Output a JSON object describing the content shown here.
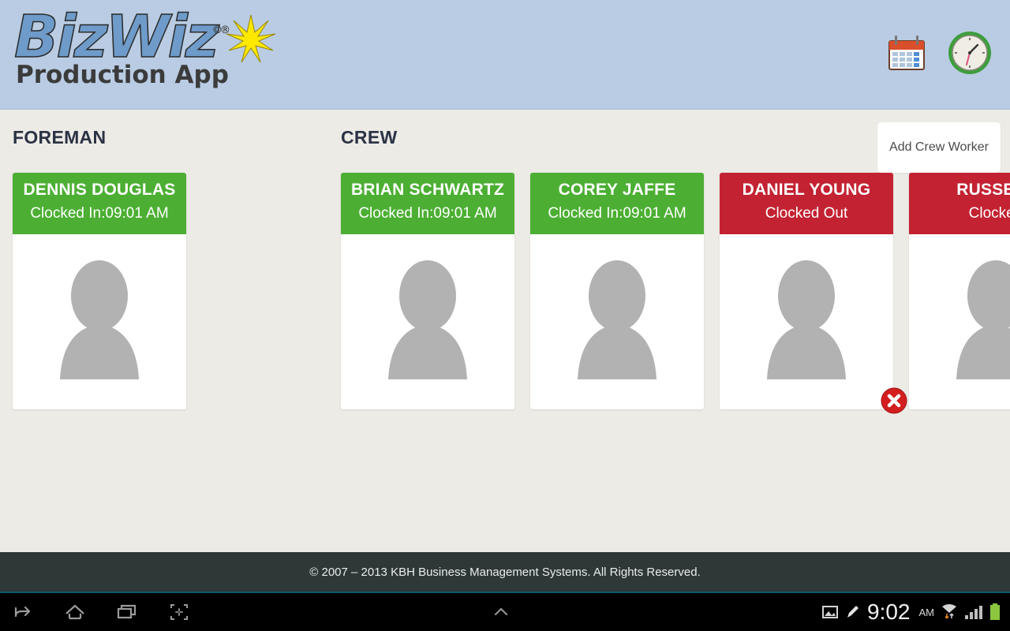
{
  "header": {
    "logo_main": "BizWiz",
    "logo_reg": "©®",
    "logo_sub": "Production App",
    "icons": [
      {
        "name": "calendar-icon",
        "label": "Calendar"
      },
      {
        "name": "clock-icon",
        "label": "Time Clock"
      }
    ]
  },
  "main": {
    "foreman_title": "FOREMAN",
    "crew_title": "CREW",
    "add_crew_label": "Add Crew Worker",
    "foreman": [
      {
        "name": "DENNIS DOUGLAS",
        "status": "Clocked In:09:01 AM",
        "state": "in",
        "has_delete": false
      }
    ],
    "crew": [
      {
        "name": "BRIAN SCHWARTZ",
        "status": "Clocked In:09:01 AM",
        "state": "in",
        "has_delete": false
      },
      {
        "name": "COREY JAFFE",
        "status": "Clocked In:09:01 AM",
        "state": "in",
        "has_delete": false
      },
      {
        "name": "DANIEL YOUNG",
        "status": "Clocked Out",
        "state": "out",
        "has_delete": true
      },
      {
        "name": "RUSSELL",
        "status": "Clocked",
        "state": "out",
        "has_delete": false
      }
    ]
  },
  "footer": {
    "copyright": "© 2007 – 2013 KBH Business Management Systems. All Rights Reserved."
  },
  "navbar": {
    "icons": [
      {
        "name": "back-icon"
      },
      {
        "name": "home-icon"
      },
      {
        "name": "recents-icon"
      },
      {
        "name": "screenshot-icon"
      }
    ],
    "center_icon": "chevron-up-icon",
    "status": {
      "time": "9:02",
      "ampm": "AM",
      "icons": [
        {
          "name": "image-icon"
        },
        {
          "name": "pencil-icon"
        },
        {
          "name": "wifi-icon"
        },
        {
          "name": "signal-icon"
        },
        {
          "name": "battery-icon"
        }
      ]
    }
  },
  "colors": {
    "header_bg": "#B9CCE3",
    "page_bg": "#EDEBE6",
    "clocked_in": "#4CAF33",
    "clocked_out": "#C32232",
    "footer_bg": "#2E3837",
    "title_text": "#2B3244",
    "logo_blue": "#6E9BC9",
    "star_yellow": "#FFE800"
  }
}
